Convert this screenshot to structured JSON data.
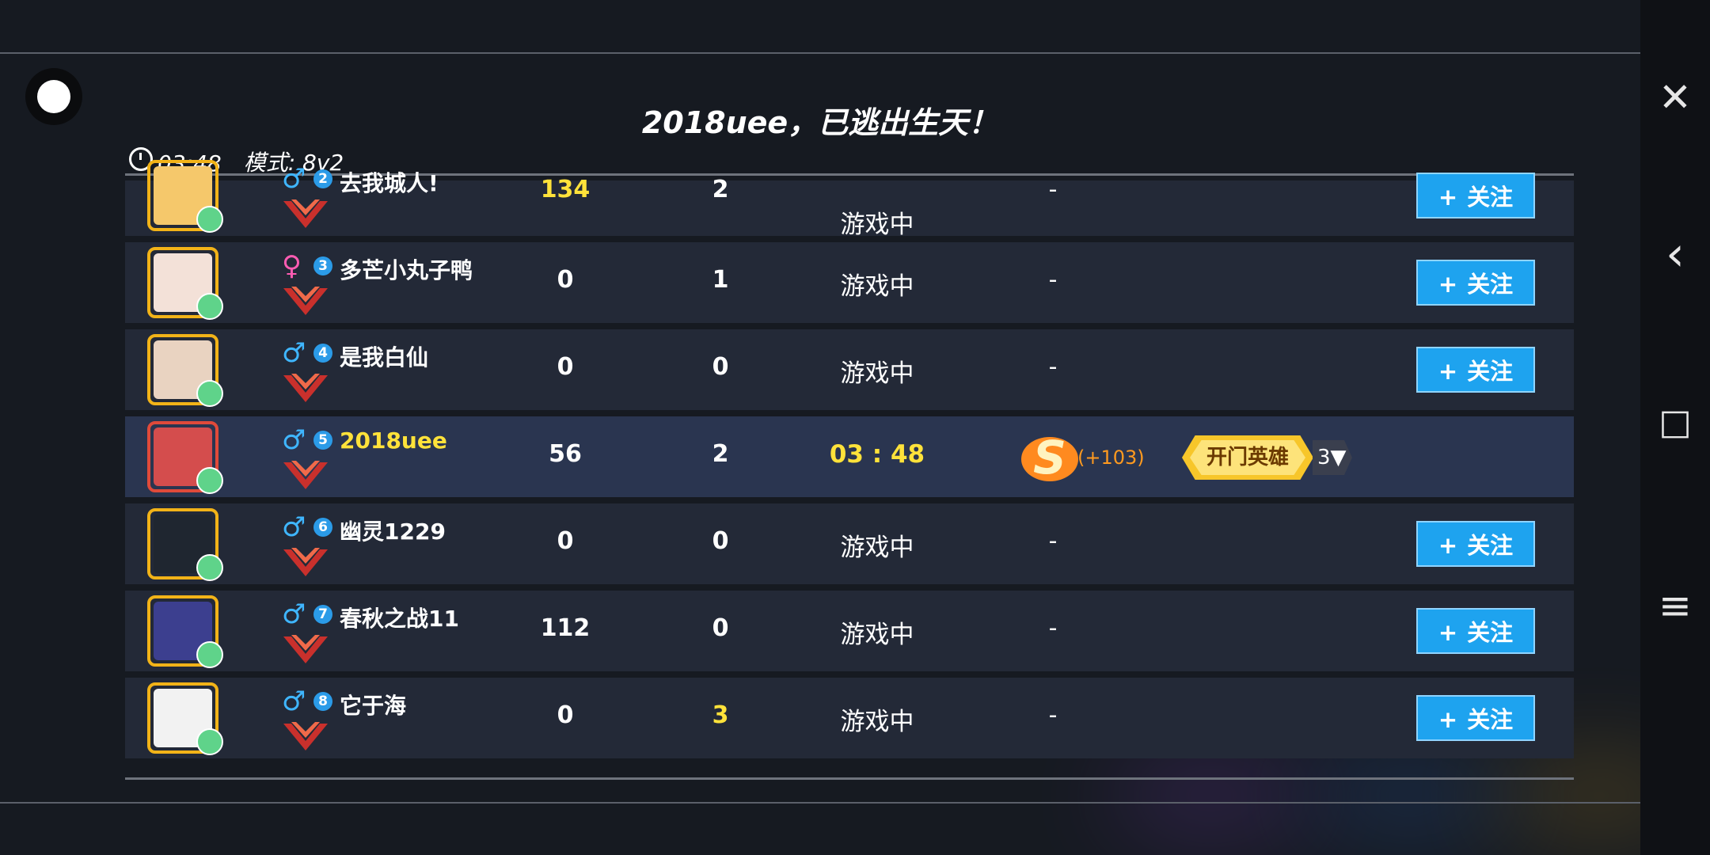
{
  "header": {
    "title": "2018uee，已逃出生天！",
    "time": "03:48",
    "mode": "模式: 8v2"
  },
  "buttons": {
    "close_icon": "close-icon",
    "follow_label": "关注",
    "follow_plus": "+"
  },
  "rows": [
    {
      "gender": "♂",
      "level": "2",
      "name": "去我城人!",
      "score": "134",
      "kills": "2",
      "status": "游戏中",
      "extra": "-",
      "follow": true,
      "score_color": "yellow"
    },
    {
      "gender": "♀",
      "level": "3",
      "name": "多芒小丸子鸭",
      "score": "0",
      "kills": "1",
      "status": "游戏中",
      "extra": "-",
      "follow": true
    },
    {
      "gender": "♂",
      "level": "4",
      "name": "是我白仙",
      "score": "0",
      "kills": "0",
      "status": "游戏中",
      "extra": "-",
      "follow": true
    },
    {
      "gender": "♂",
      "level": "5",
      "name": "2018uee",
      "score": "56",
      "kills": "2",
      "status": "03 : 48",
      "s_gain": "(+103)",
      "hero_title": "开门英雄",
      "hero_count": "3▼",
      "self": true
    },
    {
      "gender": "♂",
      "level": "6",
      "name": "幽灵1229",
      "score": "0",
      "kills": "0",
      "status": "游戏中",
      "extra": "-",
      "follow": true
    },
    {
      "gender": "♂",
      "level": "7",
      "name": "春秋之战11",
      "score": "112",
      "kills": "0",
      "status": "游戏中",
      "extra": "-",
      "follow": true
    },
    {
      "gender": "♂",
      "level": "8",
      "name": "它于海",
      "score": "0",
      "kills": "3",
      "status": "游戏中",
      "extra": "-",
      "follow": true,
      "kills_color": "yellow"
    }
  ],
  "navbar": {
    "back": "‹",
    "home": "□",
    "menu": "≡"
  }
}
